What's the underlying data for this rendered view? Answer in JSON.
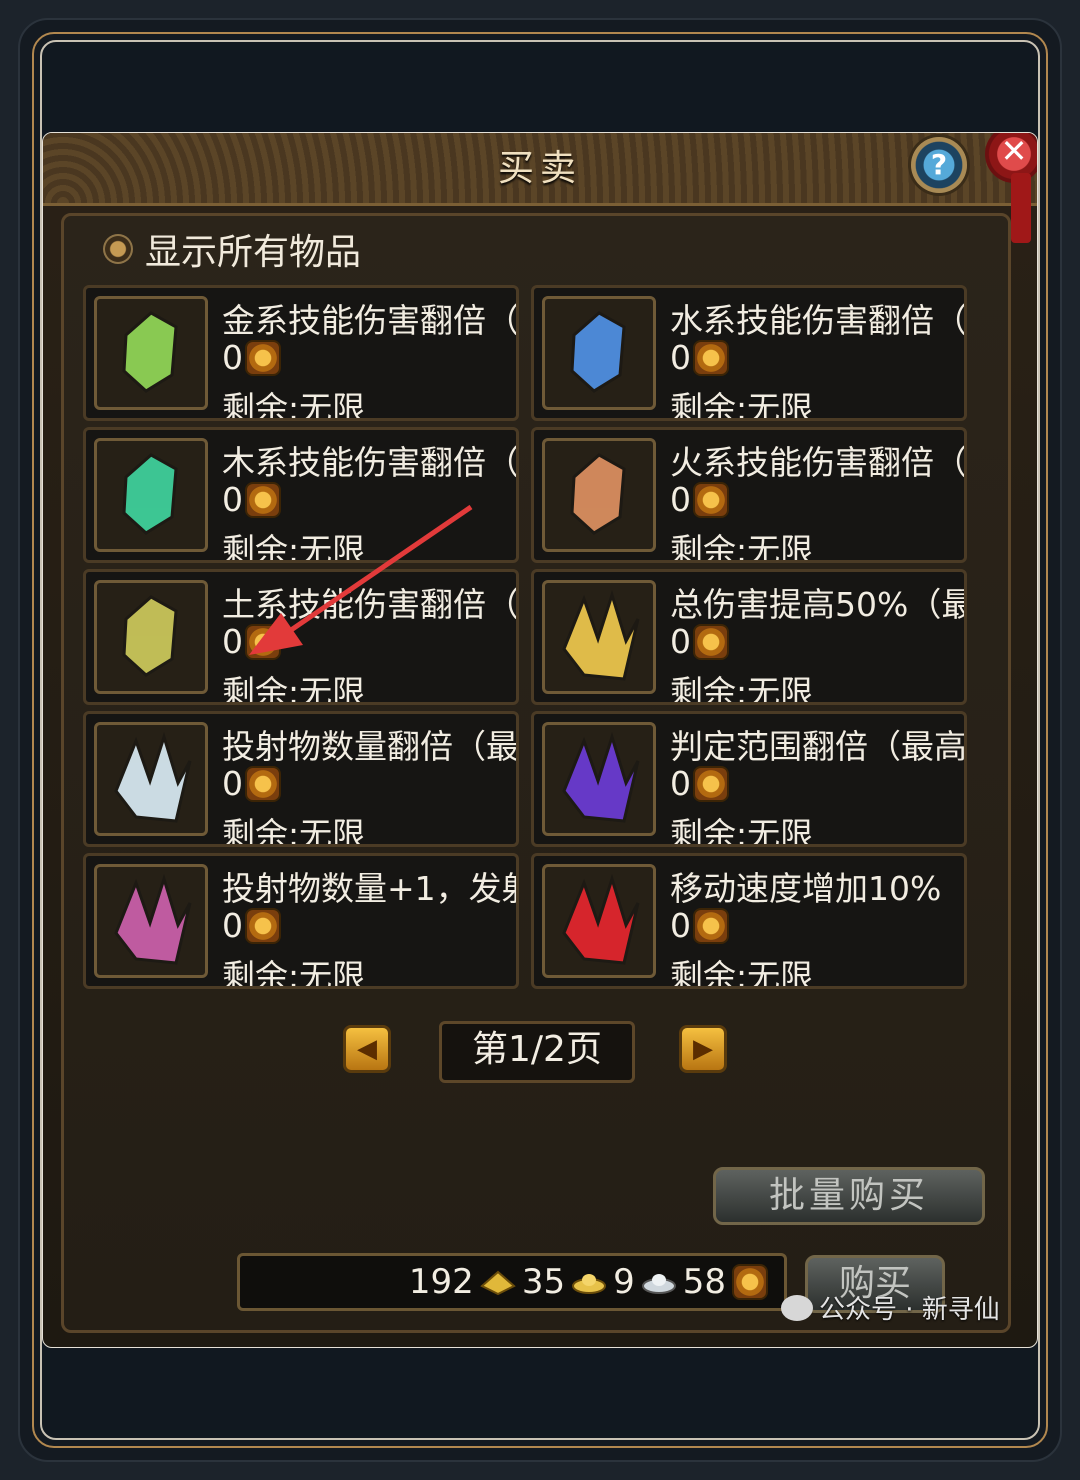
{
  "window": {
    "title": "买卖"
  },
  "filter": {
    "label": "显示所有物品"
  },
  "items": [
    {
      "name": "金系技能伤害翻倍（",
      "price": "0",
      "remain": "剩余:无限",
      "icon": "green-gem-icon",
      "color": "#8fd356"
    },
    {
      "name": "水系技能伤害翻倍（",
      "price": "0",
      "remain": "剩余:无限",
      "icon": "blue-gem-icon",
      "color": "#4f8fe0"
    },
    {
      "name": "木系技能伤害翻倍（",
      "price": "0",
      "remain": "剩余:无限",
      "icon": "teal-gem-icon",
      "color": "#3fcf9a"
    },
    {
      "name": "火系技能伤害翻倍（",
      "price": "0",
      "remain": "剩余:无限",
      "icon": "orange-gem-icon",
      "color": "#d98e5f"
    },
    {
      "name": "土系技能伤害翻倍（",
      "price": "0",
      "remain": "剩余:无限",
      "icon": "yellow-gem-icon",
      "color": "#c9c65a"
    },
    {
      "name": "总伤害提高50%（最",
      "price": "0",
      "remain": "剩余:无限",
      "icon": "gold-crystal-icon",
      "color": "#e9c44c"
    },
    {
      "name": "投射物数量翻倍（最",
      "price": "0",
      "remain": "剩余:无限",
      "icon": "white-crystal-icon",
      "color": "#d4e6ee"
    },
    {
      "name": "判定范围翻倍（最高",
      "price": "0",
      "remain": "剩余:无限",
      "icon": "purple-crystal-icon",
      "color": "#6a3bd1"
    },
    {
      "name": "投射物数量+1，发射",
      "price": "0",
      "remain": "剩余:无限",
      "icon": "rainbow-crystal-icon",
      "color": "#c85fa8"
    },
    {
      "name": "移动速度增加10%（",
      "price": "0",
      "remain": "剩余:无限",
      "icon": "red-crystal-icon",
      "color": "#e0262e"
    }
  ],
  "pager": {
    "label": "第1/2页"
  },
  "buttons": {
    "bulk_buy": "批量购买",
    "buy": "购买"
  },
  "money": {
    "gold": "192",
    "yuanbao": "35",
    "silver": "9",
    "coin": "58"
  },
  "watermark": "公众号 · 新寻仙"
}
